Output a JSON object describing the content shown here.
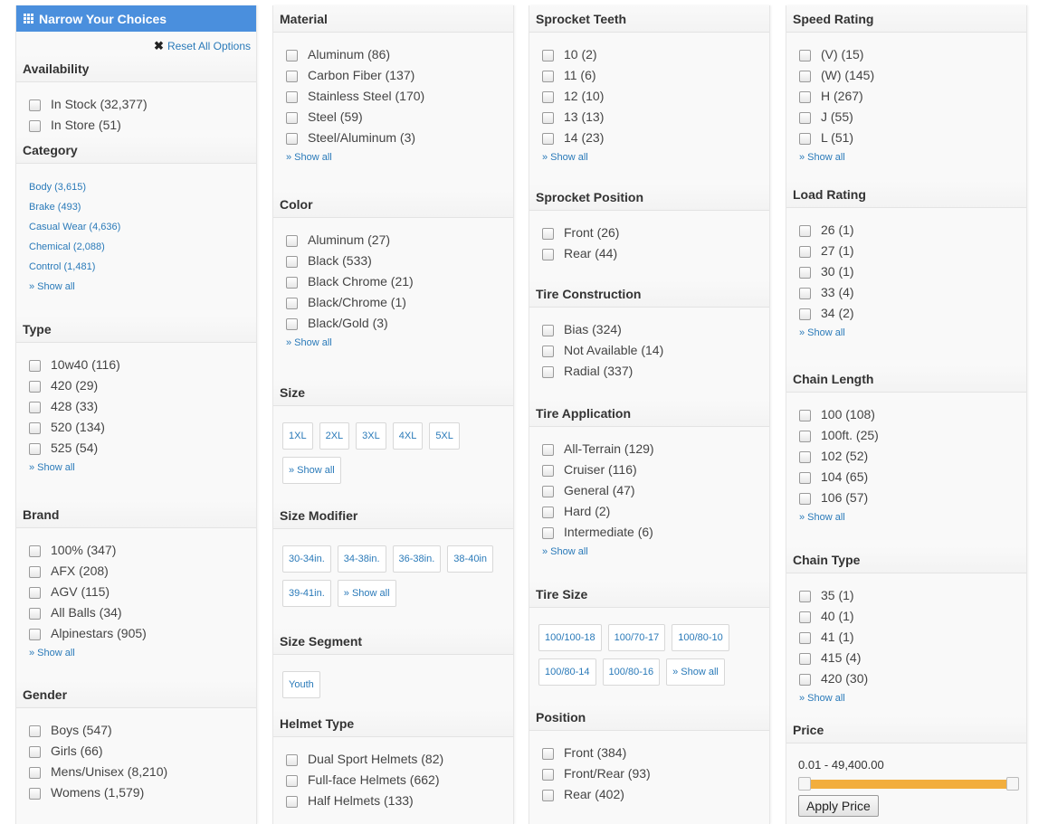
{
  "banner": {
    "title": "Narrow Your Choices",
    "reset": "Reset All Options"
  },
  "availability": {
    "title": "Availability",
    "items": [
      "In Stock (32,377)",
      "In Store (51)"
    ]
  },
  "category": {
    "title": "Category",
    "items": [
      "Body (3,615)",
      "Brake (493)",
      "Casual Wear (4,636)",
      "Chemical (2,088)",
      "Control (1,481)"
    ],
    "show_all": "» Show all"
  },
  "type": {
    "title": "Type",
    "items": [
      "10w40 (116)",
      "420 (29)",
      "428 (33)",
      "520 (134)",
      "525 (54)"
    ],
    "show_all": "» Show all"
  },
  "brand": {
    "title": "Brand",
    "items": [
      "100% (347)",
      "AFX (208)",
      "AGV (115)",
      "All Balls (34)",
      "Alpinestars (905)"
    ],
    "show_all": "» Show all"
  },
  "gender": {
    "title": "Gender",
    "items": [
      "Boys (547)",
      "Girls (66)",
      "Mens/Unisex (8,210)",
      "Womens (1,579)"
    ]
  },
  "material": {
    "title": "Material",
    "items": [
      "Aluminum (86)",
      "Carbon Fiber (137)",
      "Stainless Steel (170)",
      "Steel (59)",
      "Steel/Aluminum (3)"
    ],
    "show_all": "» Show all"
  },
  "color": {
    "title": "Color",
    "items": [
      "Aluminum (27)",
      "Black (533)",
      "Black Chrome (21)",
      "Black/Chrome (1)",
      "Black/Gold (3)"
    ],
    "show_all": "» Show all"
  },
  "size": {
    "title": "Size",
    "chips": [
      "1XL",
      "2XL",
      "3XL",
      "4XL",
      "5XL",
      "» Show all"
    ]
  },
  "size_modifier": {
    "title": "Size Modifier",
    "chips": [
      "30-34in.",
      "34-38in.",
      "36-38in.",
      "38-40in",
      "39-41in.",
      "» Show all"
    ]
  },
  "size_segment": {
    "title": "Size Segment",
    "chips": [
      "Youth"
    ]
  },
  "helmet_type": {
    "title": "Helmet Type",
    "items": [
      "Dual Sport Helmets (82)",
      "Full-face Helmets (662)",
      "Half Helmets (133)"
    ]
  },
  "sprocket_teeth": {
    "title": "Sprocket Teeth",
    "items": [
      "10 (2)",
      "11 (6)",
      "12 (10)",
      "13 (13)",
      "14 (23)"
    ],
    "show_all": "» Show all"
  },
  "sprocket_position": {
    "title": "Sprocket Position",
    "items": [
      "Front (26)",
      "Rear (44)"
    ]
  },
  "tire_construction": {
    "title": "Tire Construction",
    "items": [
      "Bias (324)",
      "Not Available (14)",
      "Radial (337)"
    ]
  },
  "tire_application": {
    "title": "Tire Application",
    "items": [
      "All-Terrain (129)",
      "Cruiser (116)",
      "General (47)",
      "Hard (2)",
      "Intermediate (6)"
    ],
    "show_all": "» Show all"
  },
  "tire_size": {
    "title": "Tire Size",
    "chips": [
      "100/100-18",
      "100/70-17",
      "100/80-10",
      "100/80-14",
      "100/80-16",
      "» Show all"
    ]
  },
  "position": {
    "title": "Position",
    "items": [
      "Front (384)",
      "Front/Rear (93)",
      "Rear (402)"
    ]
  },
  "speed_rating": {
    "title": "Speed Rating",
    "items": [
      "(V) (15)",
      "(W) (145)",
      "H (267)",
      "J (55)",
      "L (51)"
    ],
    "show_all": "» Show all"
  },
  "load_rating": {
    "title": "Load Rating",
    "items": [
      "26 (1)",
      "27 (1)",
      "30 (1)",
      "33 (4)",
      "34 (2)"
    ],
    "show_all": "» Show all"
  },
  "chain_length": {
    "title": "Chain Length",
    "items": [
      "100 (108)",
      "100ft. (25)",
      "102 (52)",
      "104 (65)",
      "106 (57)"
    ],
    "show_all": "» Show all"
  },
  "chain_type": {
    "title": "Chain Type",
    "items": [
      "35 (1)",
      "40 (1)",
      "41 (1)",
      "415 (4)",
      "420 (30)"
    ],
    "show_all": "» Show all"
  },
  "price": {
    "title": "Price",
    "range": "0.01 - 49,400.00",
    "apply": "Apply Price",
    "slider_low_fraction": 0.0,
    "slider_high_fraction": 1.0
  },
  "colors": {
    "banner": "#4a8fdd",
    "link": "#2a7ab9",
    "slider": "#f2ae3d"
  },
  "icons": {
    "banner": "grid-icon",
    "reset": "close-icon"
  }
}
